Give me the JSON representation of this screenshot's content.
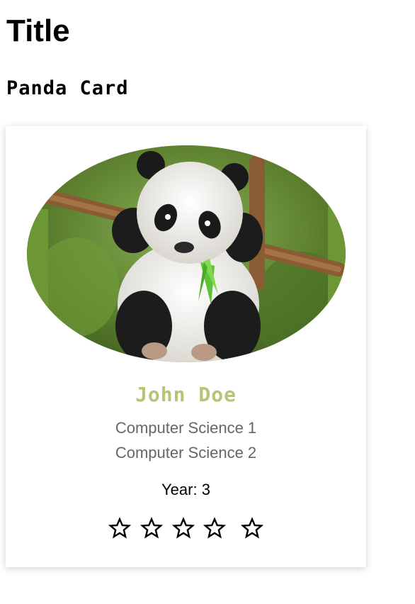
{
  "page": {
    "title": "Title"
  },
  "card": {
    "heading": "Panda Card",
    "name": "John Doe",
    "departments": [
      "Computer Science 1",
      "Computer Science 2"
    ],
    "year_text": "Year: 3",
    "rating": {
      "filled": 0,
      "max": 5
    }
  },
  "colors": {
    "name_accent": "#b5c476",
    "secondary_text": "#666666"
  },
  "icons": {
    "star": "star-outline-icon",
    "photo": "panda-photo"
  }
}
